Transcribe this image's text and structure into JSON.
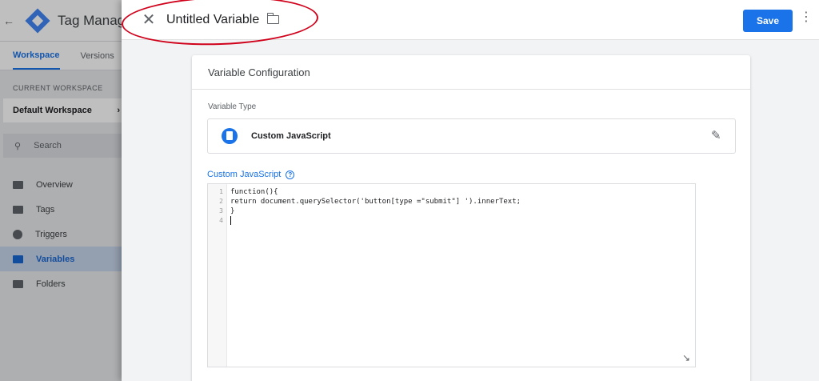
{
  "background_app": {
    "title": "Tag Manag",
    "tabs": [
      {
        "label": "Workspace"
      },
      {
        "label": "Versions"
      }
    ],
    "workspace_label": "CURRENT WORKSPACE",
    "workspace_name": "Default Workspace",
    "search_placeholder": "Search",
    "nav": [
      {
        "label": "Overview",
        "icon": "overview-icon"
      },
      {
        "label": "Tags",
        "icon": "tag-icon"
      },
      {
        "label": "Triggers",
        "icon": "trigger-icon"
      },
      {
        "label": "Variables",
        "icon": "variables-icon",
        "active": true
      },
      {
        "label": "Folders",
        "icon": "folder-icon"
      }
    ]
  },
  "panel": {
    "title": "Untitled Variable",
    "save_label": "Save",
    "annotation_color": "#d0021b"
  },
  "card": {
    "title": "Variable Configuration",
    "type_label": "Variable Type",
    "type_name": "Custom JavaScript",
    "js_label": "Custom JavaScript",
    "help_glyph": "?",
    "code_lines": [
      {
        "num": "1",
        "text": "function(){"
      },
      {
        "num": "2",
        "text": "return document.querySelector('button[type =\"submit\"] ').innerText;"
      },
      {
        "num": "3",
        "text": "}"
      },
      {
        "num": "4",
        "text": ""
      }
    ]
  },
  "colors": {
    "accent": "#1a73e8"
  }
}
